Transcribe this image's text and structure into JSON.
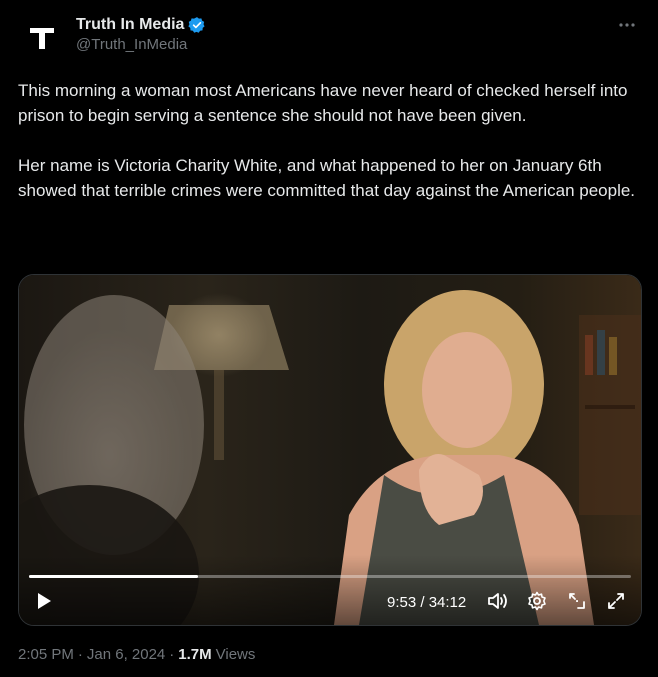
{
  "author": {
    "display_name": "Truth In Media",
    "handle": "@Truth_InMedia",
    "avatar_letter": "T",
    "verified_color": "#1d9bf0"
  },
  "tweet": {
    "paragraphs": [
      "This morning a woman most Americans have never heard of checked herself into prison to begin serving a sentence she should not have been given.",
      "Her name is Victoria Charity White, and what happened to her on January 6th showed that terrible crimes were committed that day against the American people."
    ]
  },
  "video": {
    "progress": 0.28,
    "time_display": "9:53 / 34:12",
    "icons": [
      "play-icon",
      "volume-icon",
      "settings-icon",
      "pop-out-icon",
      "fullscreen-icon"
    ]
  },
  "footer": {
    "time": "2:05 PM",
    "date": "Jan 6, 2024",
    "views_count": "1.7M",
    "views_label": "Views",
    "separator": "·"
  },
  "colors": {
    "background": "#000000",
    "text": "#e7e9ea",
    "muted": "#71767b",
    "border": "#2f3336"
  }
}
